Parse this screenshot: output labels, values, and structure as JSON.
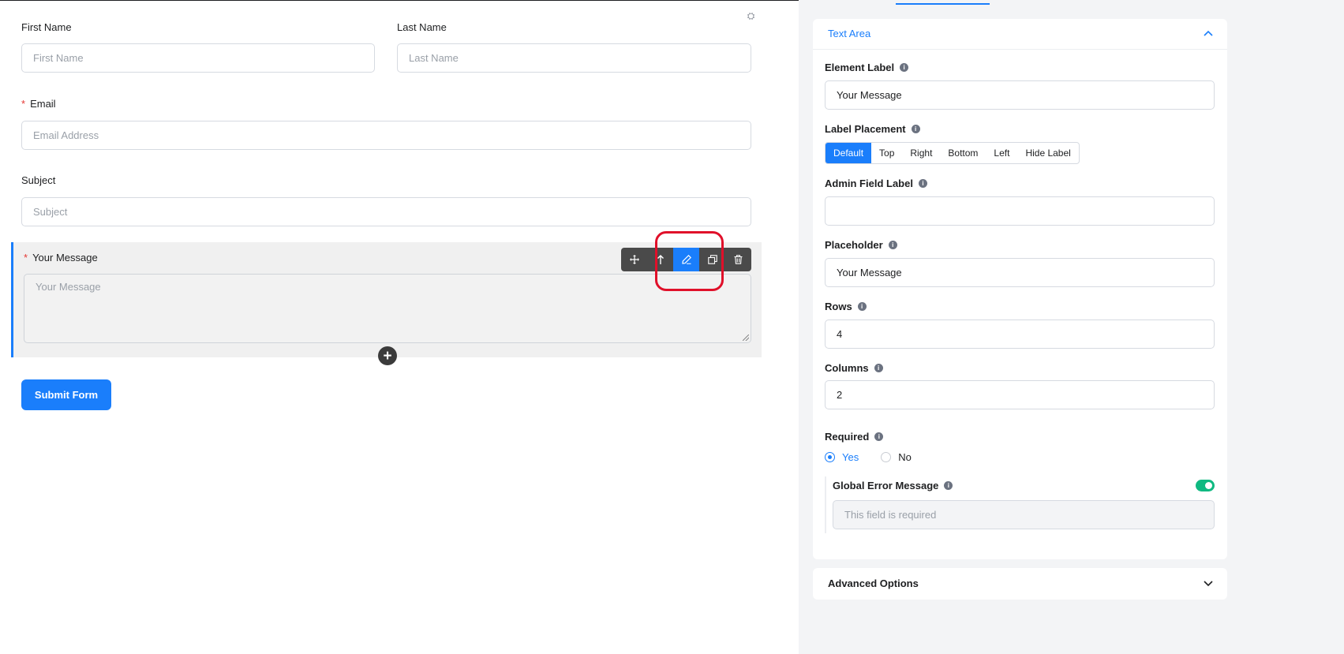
{
  "form": {
    "first_name": {
      "label": "First Name",
      "placeholder": "First Name"
    },
    "last_name": {
      "label": "Last Name",
      "placeholder": "Last Name"
    },
    "email": {
      "required_mark": "*",
      "label": "Email",
      "placeholder": "Email Address"
    },
    "subject": {
      "label": "Subject",
      "placeholder": "Subject"
    },
    "message": {
      "required_mark": "*",
      "label": "Your Message",
      "placeholder": "Your Message"
    },
    "submit_label": "Submit Form"
  },
  "toolbar": {
    "icons": [
      "move-icon",
      "move-up-icon",
      "edit-icon",
      "duplicate-icon",
      "trash-icon"
    ],
    "active": "edit-icon"
  },
  "panel": {
    "section_title": "Text Area",
    "element_label": {
      "label": "Element Label",
      "value": "Your Message"
    },
    "label_placement": {
      "label": "Label Placement",
      "options": [
        "Default",
        "Top",
        "Right",
        "Bottom",
        "Left",
        "Hide Label"
      ],
      "selected": "Default"
    },
    "admin_field_label": {
      "label": "Admin Field Label",
      "value": ""
    },
    "placeholder": {
      "label": "Placeholder",
      "value": "Your Message"
    },
    "rows": {
      "label": "Rows",
      "value": "4"
    },
    "columns": {
      "label": "Columns",
      "value": "2"
    },
    "required": {
      "label": "Required",
      "yes": "Yes",
      "no": "No",
      "selected": "Yes"
    },
    "global_error": {
      "label": "Global Error Message",
      "enabled": true,
      "placeholder": "This field is required"
    },
    "advanced_title": "Advanced Options"
  },
  "colors": {
    "accent": "#1a7efb",
    "toggle_on": "#10b981",
    "highlight": "#e0102a"
  }
}
